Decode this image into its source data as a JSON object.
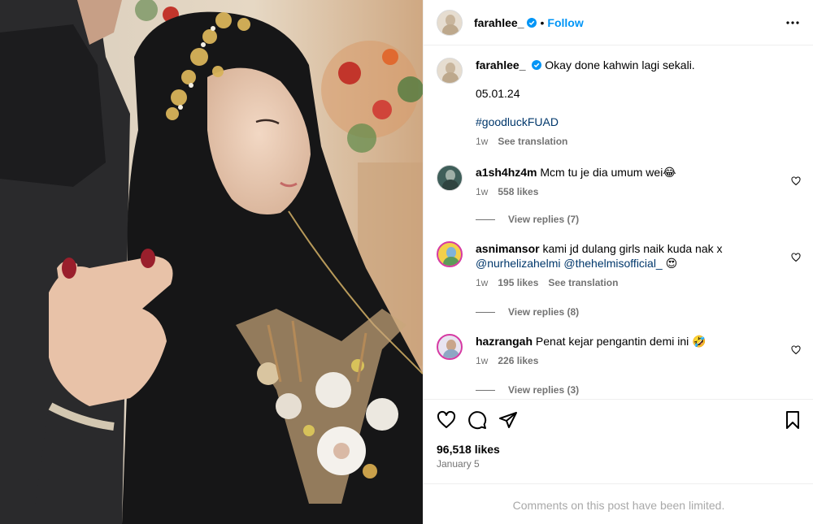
{
  "post": {
    "author": "farahlee_",
    "follow_label": "Follow",
    "caption": {
      "text": "Okay done kahwin lagi sekali.",
      "date_line": "05.01.24",
      "hashtag": "#goodluckFUAD",
      "age": "1w",
      "translate_label": "See translation"
    },
    "likes": "96,518 likes",
    "date": "January 5",
    "comments_limited": "Comments on this post have been limited."
  },
  "comments": [
    {
      "user": "a1sh4hz4m",
      "text": "Mcm tu je dia umum wei😂",
      "age": "1w",
      "likes": "558 likes",
      "replies": "View replies (7)"
    },
    {
      "user": "asnimansor",
      "text": "kami jd dulang girls naik kuda nak x",
      "mention1": "@nurhelizahelmi",
      "mention2": "@thehelmisofficial_",
      "emoji": "😍",
      "age": "1w",
      "likes": "195 likes",
      "translate_label": "See translation",
      "replies": "View replies (8)"
    },
    {
      "user": "hazrangah",
      "text": "Penat kejar pengantin demi ini 🤣",
      "age": "1w",
      "likes": "226 likes",
      "replies": "View replies (3)"
    }
  ],
  "icons": {
    "more": "more-options-icon",
    "like": "heart-icon",
    "comment": "comment-icon",
    "share": "share-icon",
    "save": "bookmark-icon",
    "verified": "verified-badge-icon"
  },
  "colors": {
    "link": "#00376b",
    "follow": "#0095f6",
    "muted": "#737373",
    "verified": "#0095f6"
  }
}
